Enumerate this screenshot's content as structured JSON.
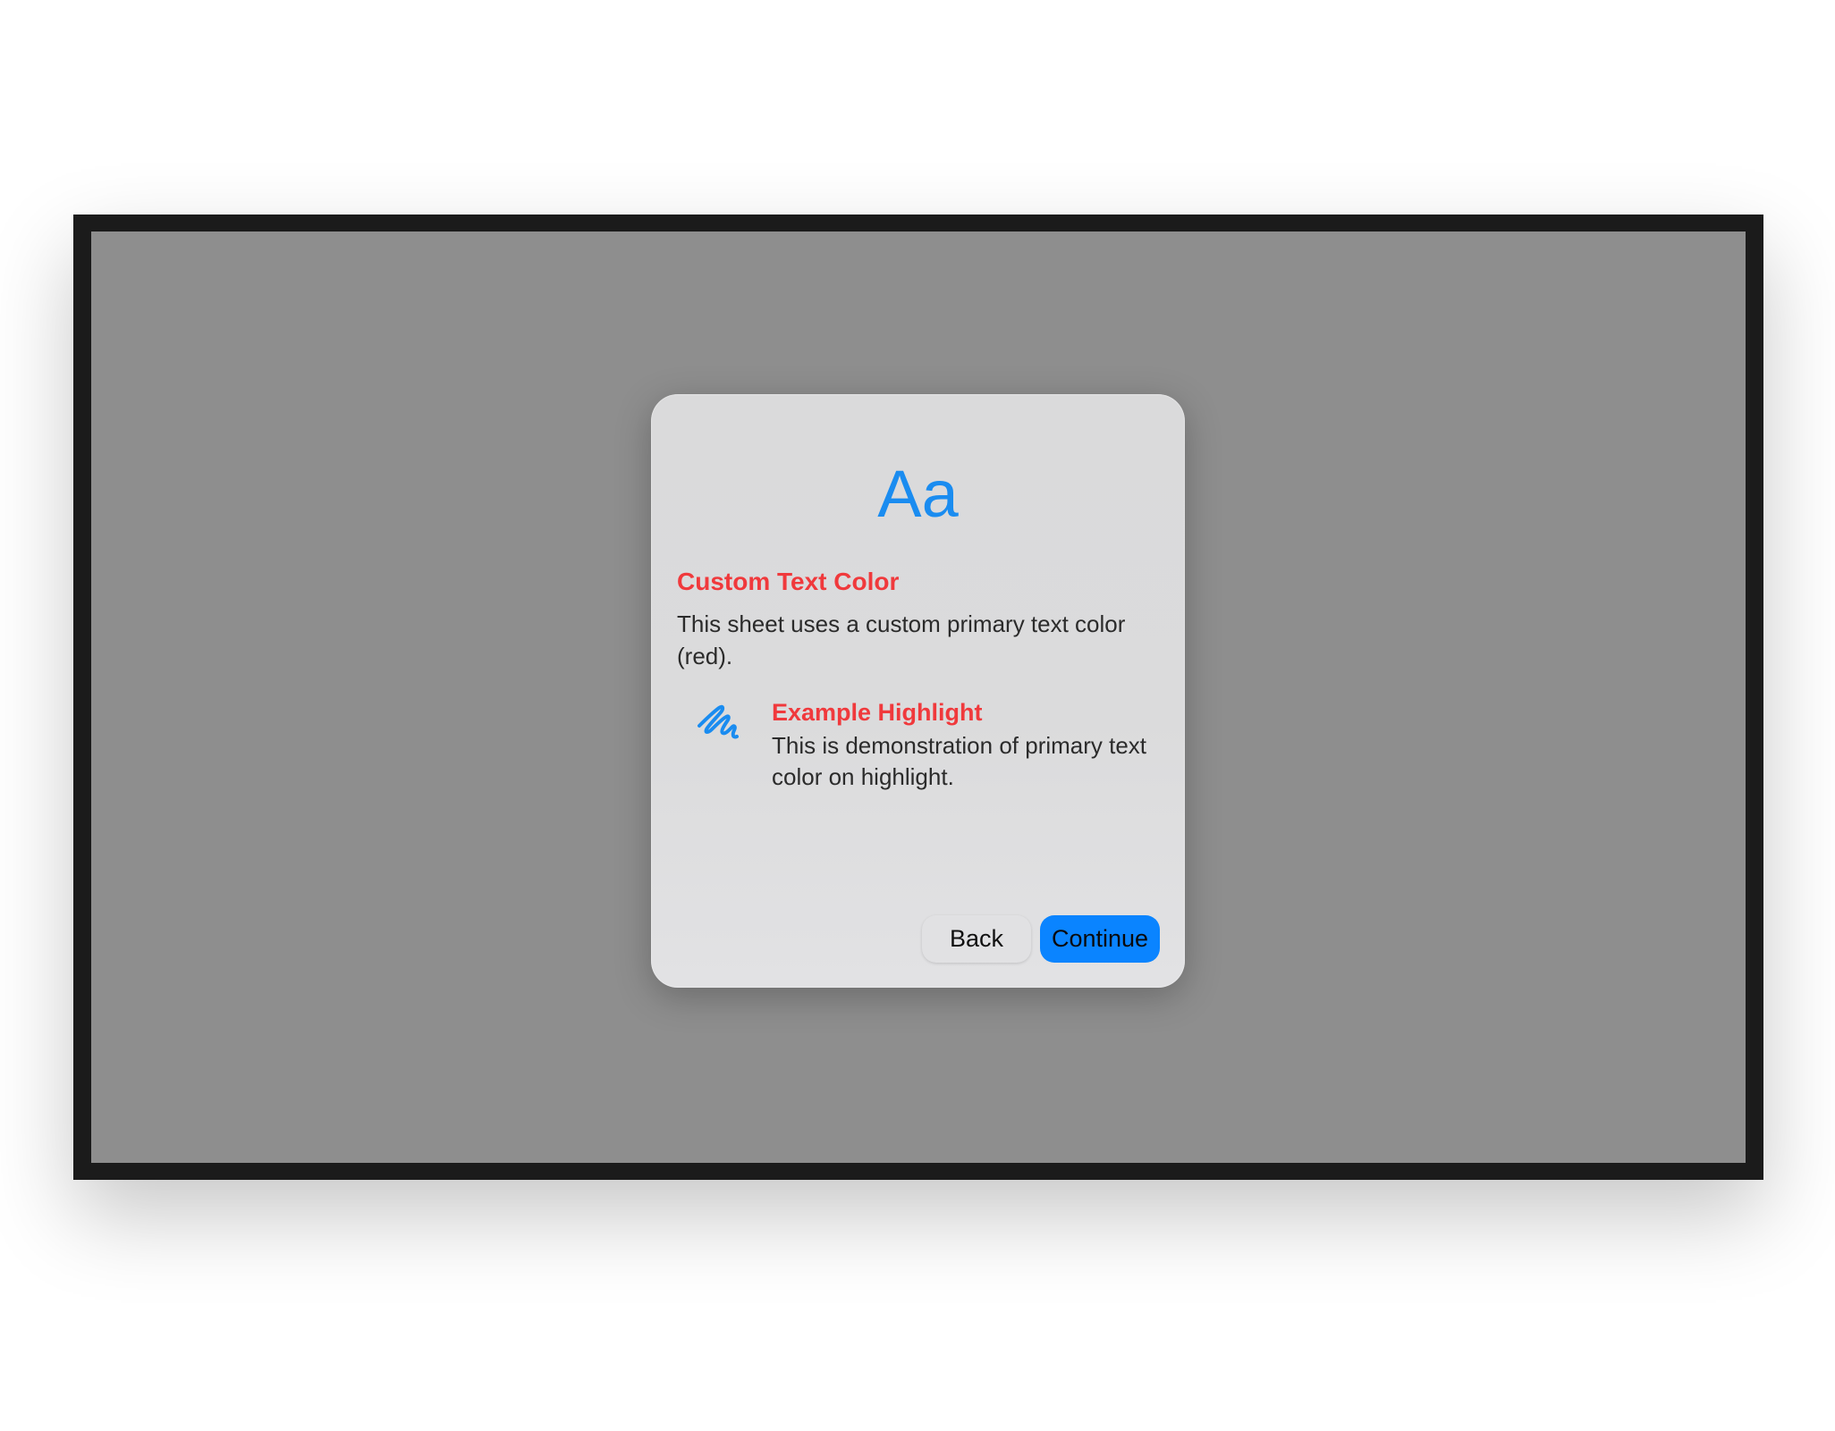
{
  "sheet": {
    "hero_glyph": "Aa",
    "title": "Custom Text Color",
    "description": "This sheet uses a custom primary text color (red).",
    "feature": {
      "icon": "scribble-icon",
      "title": "Example Highlight",
      "description": "This is demonstration of primary text color on highlight."
    },
    "buttons": {
      "back_label": "Back",
      "continue_label": "Continue"
    }
  },
  "colors": {
    "primary_text": "#f0393c",
    "accent": "#0a84ff",
    "glyph": "#1a8cf0",
    "screen_dim": "#8e8e8e",
    "bezel": "#1b1b1b"
  }
}
